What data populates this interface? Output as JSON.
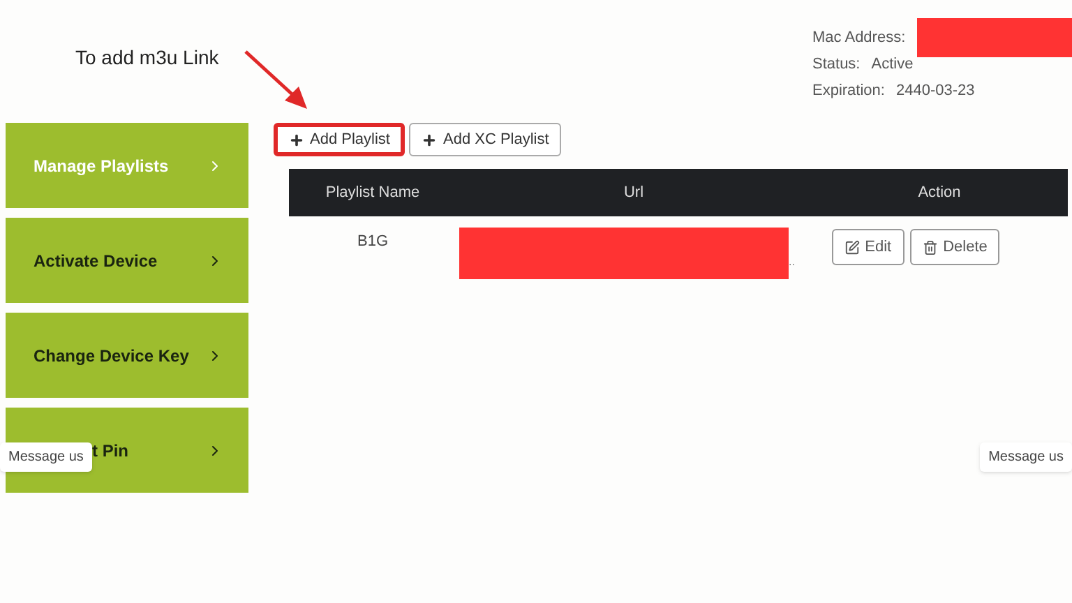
{
  "annotation": {
    "text": "To add m3u Link"
  },
  "device_info": [
    {
      "label": "Mac Address:",
      "redacted": true
    },
    {
      "label": "Status:",
      "value": "Active"
    },
    {
      "label": "Expiration:",
      "value": "2440-03-23"
    }
  ],
  "sidebar": {
    "items": [
      {
        "label": "Manage Playlists",
        "selected": true
      },
      {
        "label": "Activate Device",
        "selected": false
      },
      {
        "label": "Change Device Key",
        "selected": false
      },
      {
        "label": "t Pin",
        "selected": false
      }
    ]
  },
  "toolbar": {
    "buttons": [
      {
        "label": "Add Playlist",
        "highlighted": true
      },
      {
        "label": "Add XC Playlist",
        "highlighted": false
      }
    ]
  },
  "table": {
    "columns": [
      "Playlist Name",
      "Url",
      "Action"
    ],
    "rows": [
      {
        "name": "B1G",
        "url_redacted": true,
        "url_tail": "..",
        "actions": [
          {
            "kind": "edit",
            "label": "Edit"
          },
          {
            "kind": "delete",
            "label": "Delete"
          }
        ]
      }
    ]
  },
  "chat_bubbles": [
    {
      "label": "Message us"
    },
    {
      "label": "Message us"
    }
  ]
}
